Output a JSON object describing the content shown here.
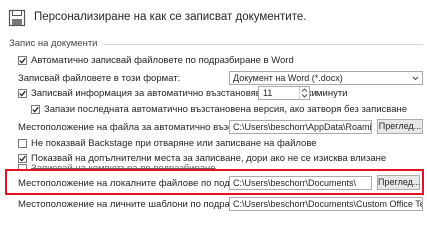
{
  "header": {
    "title": "Персонализиране на как се записват документите."
  },
  "section": {
    "title": "Запис на документи"
  },
  "rows": {
    "autorecover_cb": {
      "label": "Автоматично записвай файловете по подразбиране в Word",
      "checked": true
    },
    "format": {
      "label": "Записвай файловете в този формат:",
      "value": "Документ на Word (*.docx)"
    },
    "autorecover_info": {
      "label": "Записвай информация за автоматично възстановяване на всеки",
      "checked": true,
      "value": "11",
      "unit": "минути"
    },
    "keep_last": {
      "label": "Запази последната автоматично възстановена версия, ако затворя без записване",
      "checked": true
    },
    "autorecover_location": {
      "label": "Местоположение на файла за автоматично възстановяване:",
      "value": "C:\\Users\\beschorr\\AppData\\Roaming\\M",
      "button": "Преглед..."
    },
    "no_backstage": {
      "label": "Не показвай Backstage при отваряне или записване на файлове",
      "checked": false
    },
    "show_more_places": {
      "label": "Показвай на допълнителни места за записване, дори ако не се изисква влизане",
      "checked": true
    },
    "save_to_computer": {
      "label": "Записвай на компютъра по подразбиране",
      "checked": false
    },
    "local_location": {
      "label": "Местоположение на локалните файлове по подразбиране:",
      "value": "C:\\Users\\beschorr\\Documents\\",
      "button": "Преглед..."
    },
    "templates_location": {
      "label": "Местоположение на личните шаблони по подразбиране:",
      "value": "C:\\Users\\beschorr\\Documents\\Custom Office Templates"
    }
  },
  "colors": {
    "highlight": "#e81123",
    "check": "#262626"
  }
}
